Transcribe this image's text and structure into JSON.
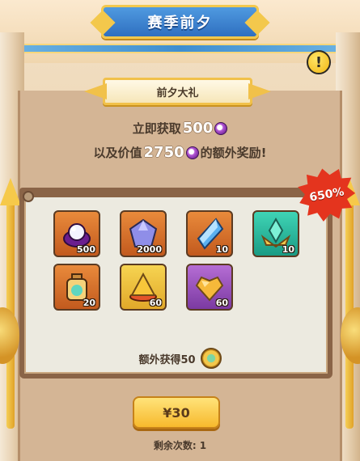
{
  "header": {
    "title": "赛季前夕"
  },
  "ribbon": {
    "label": "前夕大礼"
  },
  "offer": {
    "line1_prefix": "立即获取",
    "line1_amount": "500",
    "line2_prefix": "以及价值",
    "line2_amount": "2750",
    "line2_suffix": "的额外奖励!"
  },
  "badge": {
    "label": "650%"
  },
  "rewards": [
    {
      "name": "purple-pearl-icon",
      "count": "500",
      "color": "orange"
    },
    {
      "name": "purple-crystal-icon",
      "count": "2000",
      "color": "orange"
    },
    {
      "name": "blue-crystal-icon",
      "count": "10",
      "color": "orange"
    },
    {
      "name": "green-crystal-crown-icon",
      "count": "10",
      "color": "teal"
    },
    {
      "name": "potion-bottle-icon",
      "count": "20",
      "color": "orange"
    },
    {
      "name": "gold-pyramid-icon",
      "count": "60",
      "color": "yellow"
    },
    {
      "name": "gold-heart-gem-icon",
      "count": "60",
      "color": "purple"
    }
  ],
  "extra": {
    "label": "额外获得50"
  },
  "purchase": {
    "price": "¥30"
  },
  "remaining": {
    "label": "剩余次数: 1"
  },
  "colors": {
    "title_blue": "#2f6fc0",
    "gold": "#f3c84c",
    "badge_red": "#e4341e"
  }
}
